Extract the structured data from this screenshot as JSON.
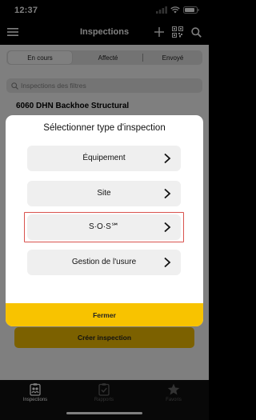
{
  "status_bar": {
    "time": "12:37"
  },
  "nav": {
    "title": "Inspections",
    "icons": [
      "menu-icon",
      "plus-icon",
      "qr-code-icon",
      "search-icon"
    ]
  },
  "segments": {
    "items": [
      "En cours",
      "Affecté",
      "Envoyé"
    ],
    "selected": "En cours"
  },
  "search": {
    "placeholder": "Inspections des filtres"
  },
  "card": {
    "title": "6060 DHN Backhoe Structural"
  },
  "create_button": {
    "label": "Créer inspection"
  },
  "tabs": [
    {
      "label": "Inspections",
      "icon": "clipboard-people-icon",
      "active": true
    },
    {
      "label": "Rapports",
      "icon": "report-check-icon",
      "active": false
    },
    {
      "label": "Favoris",
      "icon": "star-icon",
      "active": false
    }
  ],
  "modal": {
    "title": "Sélectionner type d'inspection",
    "options": [
      {
        "label": "Équipement"
      },
      {
        "label": "Site"
      },
      {
        "label": "S·O·S℠",
        "highlighted": true
      },
      {
        "label": "Gestion de l'usure"
      }
    ],
    "close_label": "Fermer"
  },
  "colors": {
    "accent": "#f8c300",
    "highlight": "#d9534f"
  }
}
